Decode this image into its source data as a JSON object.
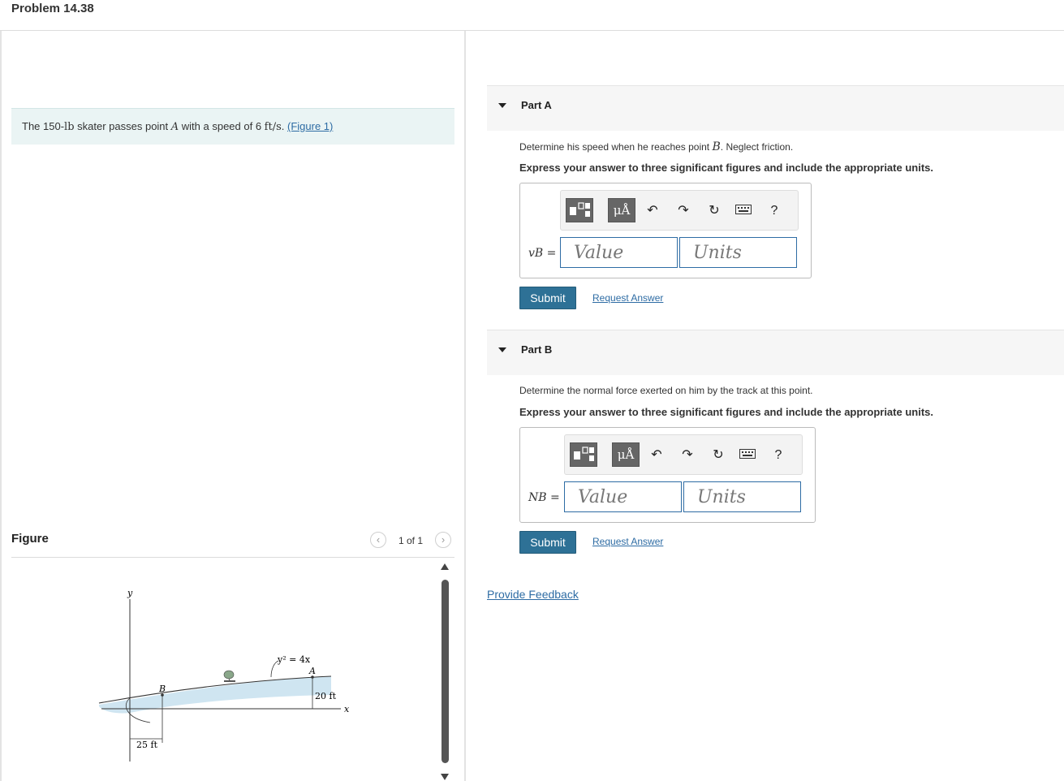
{
  "header": {
    "title": "Problem 14.38"
  },
  "problem": {
    "text_pre": "The ",
    "weight": "150-",
    "weight_unit": "lb",
    "text_mid": " skater passes point ",
    "point": "A",
    "text_speed": " with a speed of 6 ",
    "speed_unit": "ft/s",
    "text_end": ". ",
    "figure_link": "(Figure 1)"
  },
  "figure": {
    "label": "Figure",
    "pager": "1 of 1",
    "prev_icon": "chevron-left-icon",
    "next_icon": "chevron-right-icon",
    "diagram": {
      "y_axis": "y",
      "x_axis": "x",
      "equation": "y² = 4x",
      "point_a": "A",
      "point_b": "B",
      "height_dim": "20 ft",
      "width_dim": "25 ft"
    }
  },
  "parts": [
    {
      "title": "Part A",
      "question_pre": "Determine his speed when he reaches point ",
      "question_var": "B",
      "question_post": ". Neglect friction.",
      "instruction": "Express your answer to three significant figures and include the appropriate units.",
      "var_label": "vB =",
      "value_placeholder": "Value",
      "units_placeholder": "Units",
      "submit": "Submit",
      "request": "Request Answer"
    },
    {
      "title": "Part B",
      "question": "Determine the normal force exerted on him by the track at this point.",
      "instruction": "Express your answer to three significant figures and include the appropriate units.",
      "var_label": "NB =",
      "value_placeholder": "Value",
      "units_placeholder": "Units",
      "submit": "Submit",
      "request": "Request Answer"
    }
  ],
  "toolbar": {
    "units_button": "μÅ",
    "help": "?",
    "icons": [
      "templates-icon",
      "units-icon",
      "undo-icon",
      "redo-icon",
      "reset-icon",
      "keyboard-icon",
      "help-icon"
    ]
  },
  "feedback": "Provide Feedback"
}
